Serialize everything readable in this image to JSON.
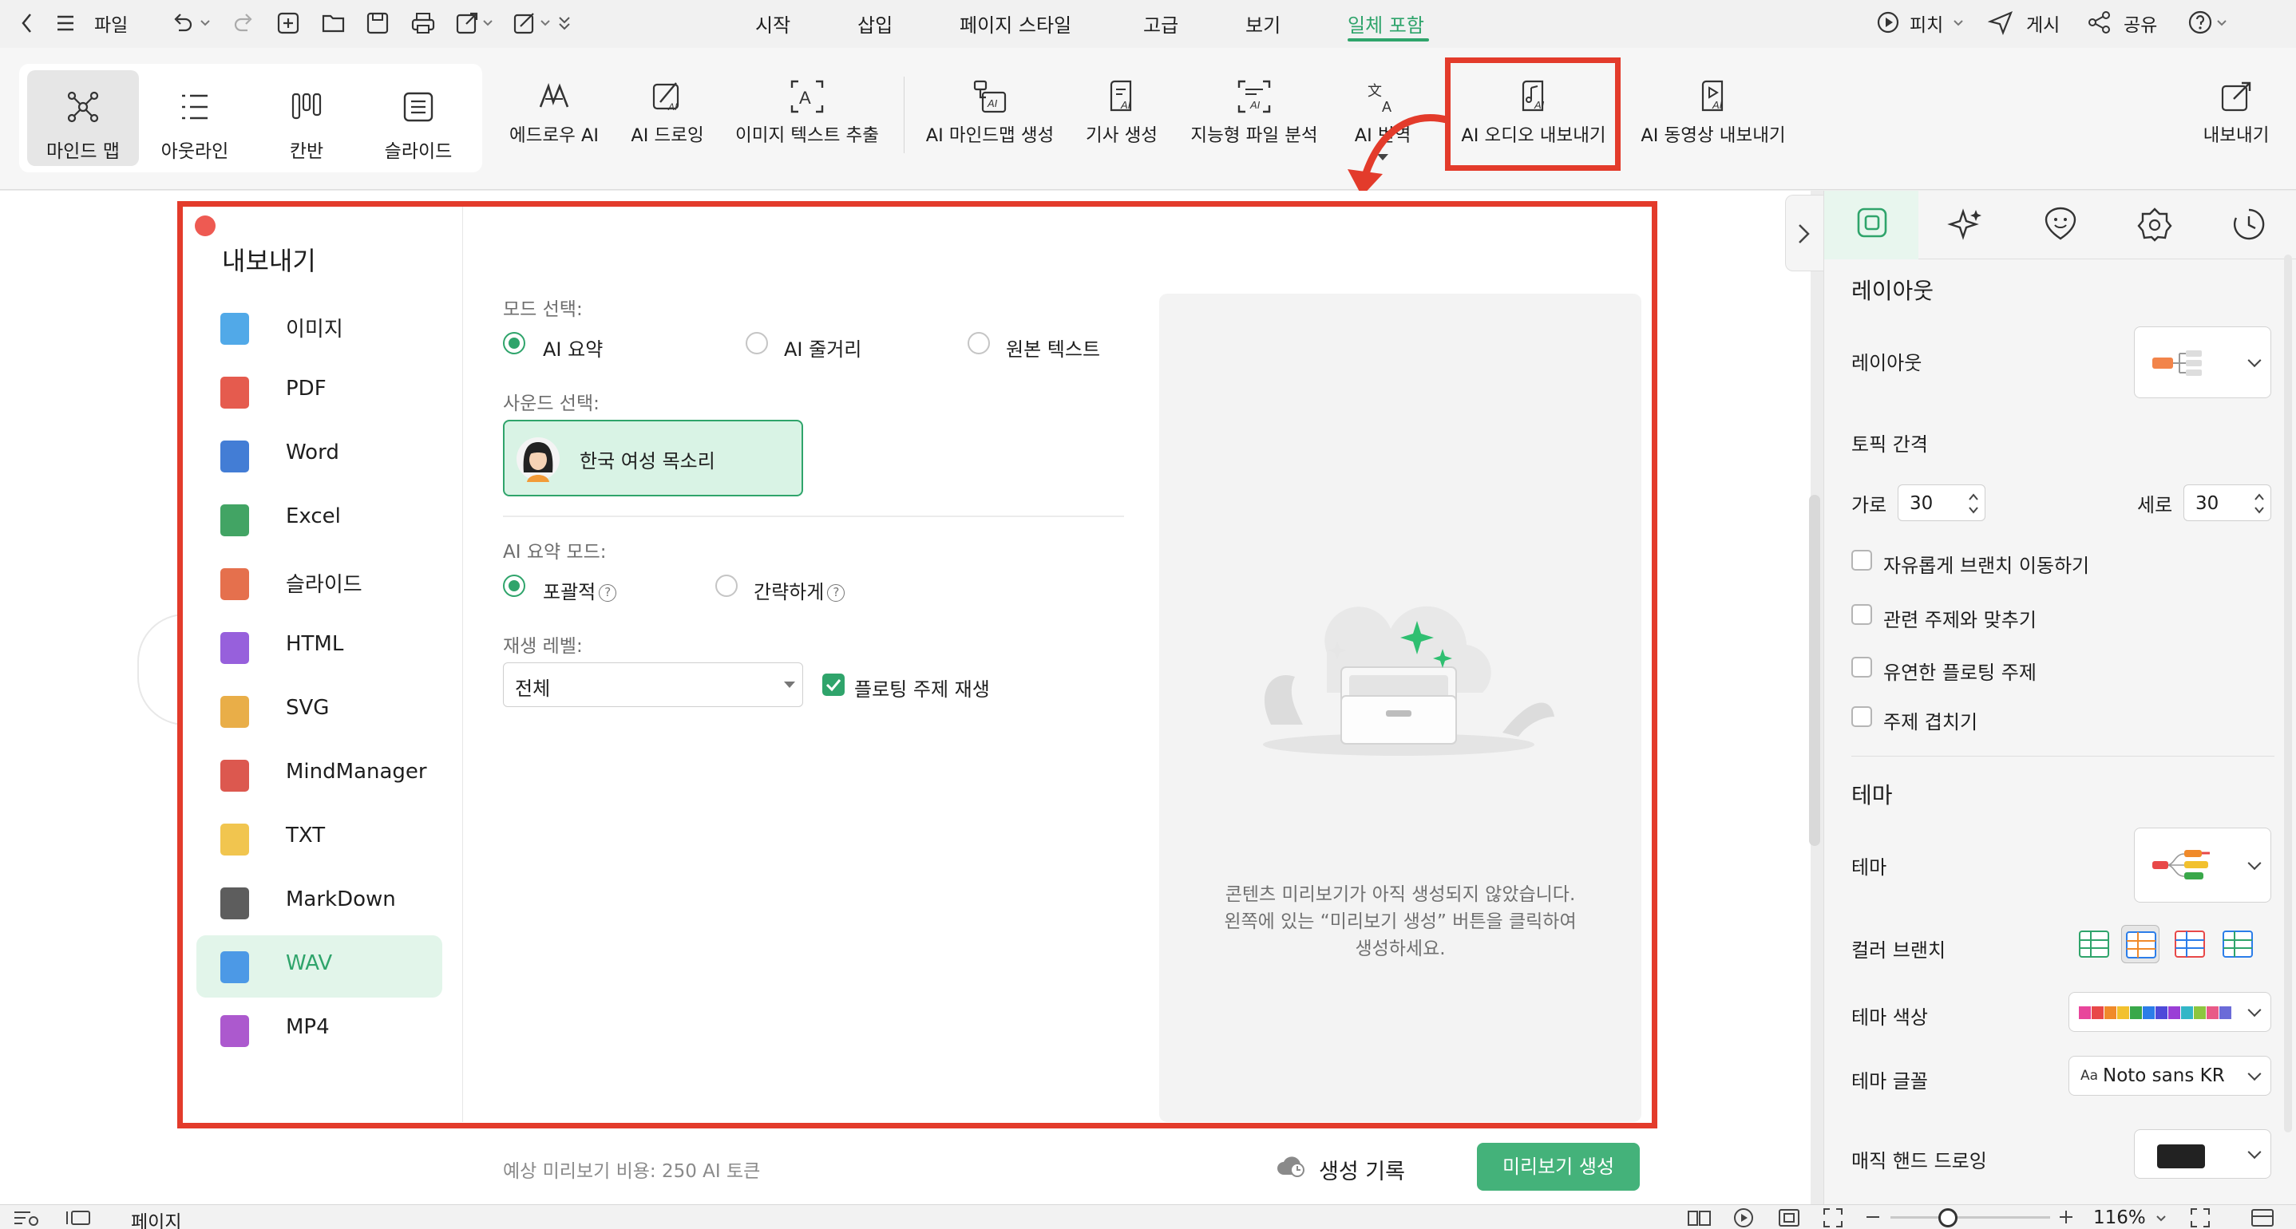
{
  "topbar": {
    "file_label": "파일",
    "tabs": [
      {
        "label": "시작",
        "active": false
      },
      {
        "label": "삽입",
        "active": false
      },
      {
        "label": "페이지 스타일",
        "active": false
      },
      {
        "label": "고급",
        "active": false
      },
      {
        "label": "보기",
        "active": false
      },
      {
        "label": "일체 포함",
        "active": true
      }
    ],
    "pitch_label": "피치",
    "post_label": "게시",
    "share_label": "공유",
    "accent_color": "#2fa46b"
  },
  "ribbon": {
    "views": [
      {
        "label": "마인드 맵",
        "icon": "mindmap-icon",
        "selected": true
      },
      {
        "label": "아웃라인",
        "icon": "outline-icon",
        "selected": false
      },
      {
        "label": "칸반",
        "icon": "kanban-icon",
        "selected": false
      },
      {
        "label": "슬라이드",
        "icon": "slide-icon",
        "selected": false
      }
    ],
    "tools": [
      {
        "label": "에드로우 AI",
        "icon": "edraw-ai-icon"
      },
      {
        "label": "AI 드로잉",
        "icon": "ai-drawing-icon"
      },
      {
        "label": "이미지 텍스트 추출",
        "icon": "image-text-extract-icon"
      },
      {
        "label": "AI 마인드맵 생성",
        "icon": "ai-mindmap-icon"
      },
      {
        "label": "기사 생성",
        "icon": "article-icon"
      },
      {
        "label": "지능형 파일 분석",
        "icon": "file-analysis-icon"
      },
      {
        "label": "AI 번역",
        "icon": "translate-icon"
      },
      {
        "label": "AI 오디오 내보내기",
        "icon": "audio-export-icon"
      },
      {
        "label": "AI 동영상 내보내기",
        "icon": "video-export-icon"
      }
    ],
    "export_label": "내보내기"
  },
  "dialog": {
    "title": "내보내기",
    "formats": [
      {
        "label": "이미지",
        "color": "#3ea0e6"
      },
      {
        "label": "PDF",
        "color": "#e2493b"
      },
      {
        "label": "Word",
        "color": "#2f6fd0"
      },
      {
        "label": "Excel",
        "color": "#2e9a53"
      },
      {
        "label": "슬라이드",
        "color": "#e2613a"
      },
      {
        "label": "HTML",
        "color": "#8c4fd8"
      },
      {
        "label": "SVG",
        "color": "#e7a534"
      },
      {
        "label": "MindManager",
        "color": "#d8463c"
      },
      {
        "label": "TXT",
        "color": "#f0bf3c"
      },
      {
        "label": "MarkDown",
        "color": "#4b4b4b"
      },
      {
        "label": "WAV",
        "color": "#3c8fe6"
      },
      {
        "label": "MP4",
        "color": "#a347c9"
      }
    ],
    "selected_format": "WAV",
    "mode_label": "모드 선택:",
    "modes": [
      {
        "label": "AI 요약",
        "checked": true
      },
      {
        "label": "AI 줄거리",
        "checked": false
      },
      {
        "label": "원본 텍스트",
        "checked": false
      }
    ],
    "sound_label": "사운드 선택:",
    "voice_label": "한국 여성 목소리",
    "summary_mode_label": "AI 요약 모드:",
    "summary_modes": [
      {
        "label": "포괄적",
        "checked": true
      },
      {
        "label": "간략하게",
        "checked": false
      }
    ],
    "play_level_label": "재생 레벨:",
    "play_level_value": "전체",
    "floating_label": "플로팅 주제 재생",
    "floating_checked": true,
    "preview_text_line1": "콘텐츠 미리보기가 아직 생성되지 않았습니다.",
    "preview_text_line2": "왼쪽에 있는 “미리보기 생성” 버튼을 클릭하여",
    "preview_text_line3": "생성하세요.",
    "cost_text": "예상 미리보기 비용: 250 AI 토큰",
    "history_label": "생성 기록",
    "generate_label": "미리보기 생성"
  },
  "right_panel": {
    "layout_section": "레이아웃",
    "layout_label": "레이아웃",
    "topic_spacing": "토픽 간격",
    "horizontal_label": "가로",
    "horizontal_value": "30",
    "vertical_label": "세로",
    "vertical_value": "30",
    "checkboxes": [
      "자유롭게 브랜치 이동하기",
      "관련 주제와 맞추기",
      "유연한 플로팅 주제",
      "주제 겹치기"
    ],
    "theme_section": "테마",
    "theme_label": "테마",
    "color_branch_label": "컬러 브랜치",
    "theme_color_label": "테마 색상",
    "theme_font_label": "테마 글꼴",
    "theme_font_prefix": "Aa",
    "theme_font_value": "Noto sans KR",
    "hand_drawing_label": "매직 핸드 드로잉",
    "palette": [
      "#e8459b",
      "#e84848",
      "#f08a2a",
      "#f2c12e",
      "#3aa84a",
      "#2b7de9",
      "#4e4ad9",
      "#9a3fd6",
      "#33b6c7",
      "#8dc63f",
      "#e85a87",
      "#6b6bd8"
    ]
  },
  "bottombar": {
    "page_label": "페이지",
    "zoom": "116%"
  }
}
